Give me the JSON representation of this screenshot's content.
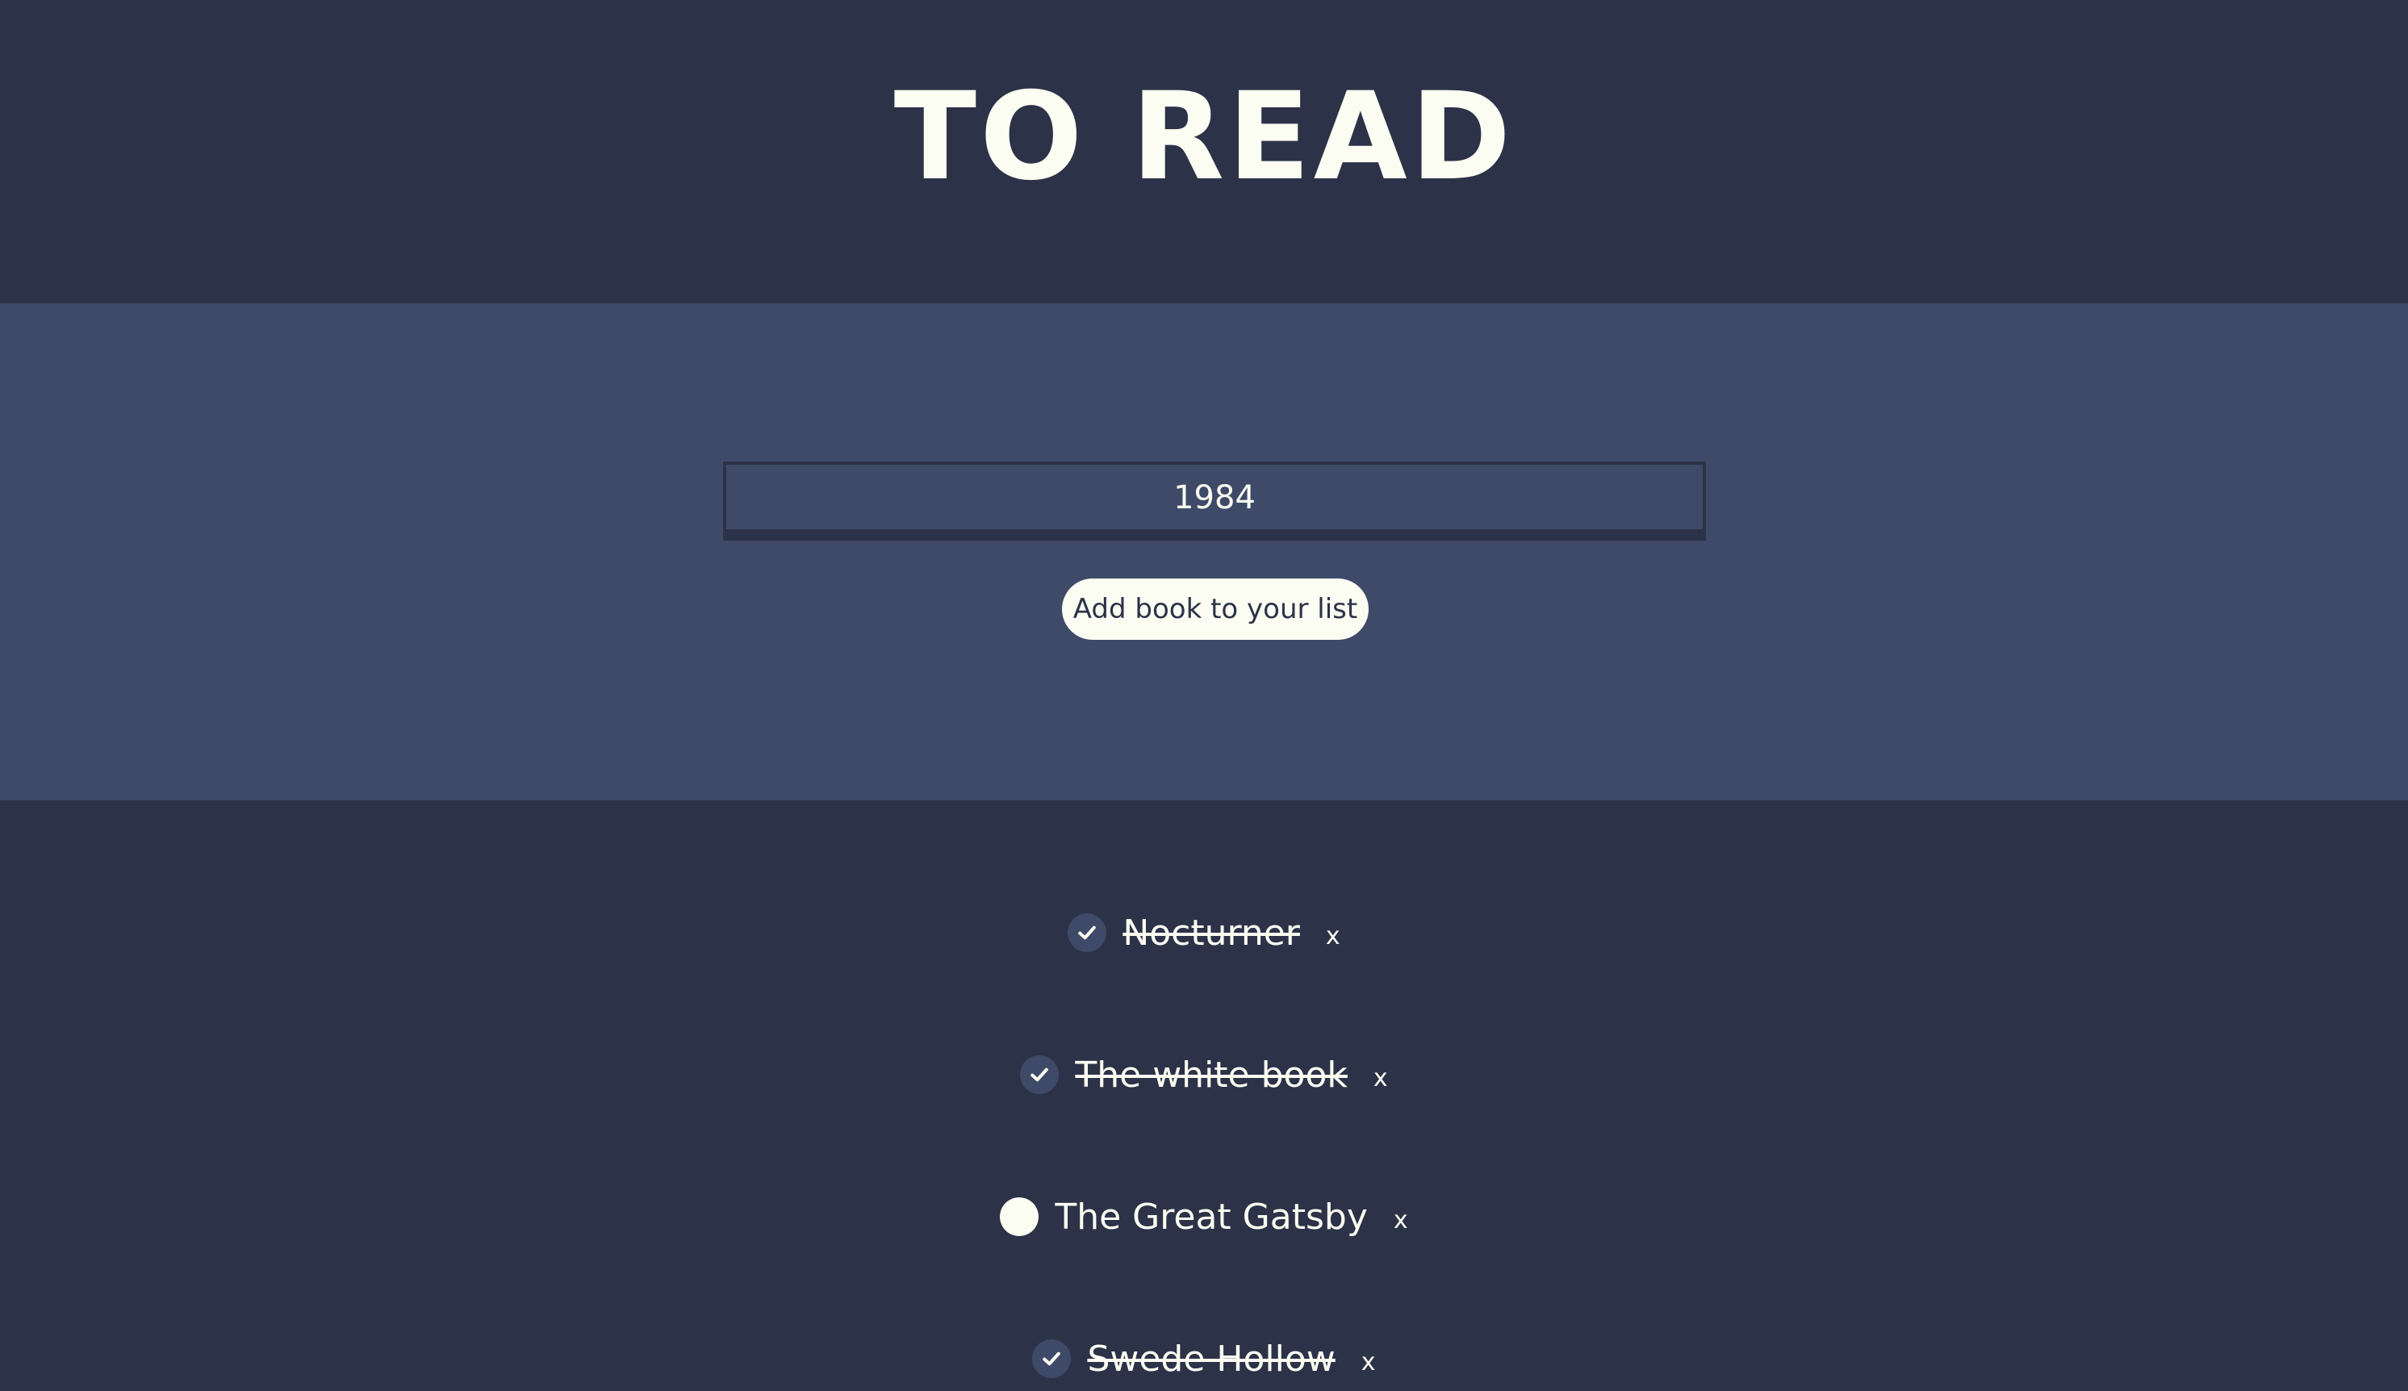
{
  "header": {
    "title": "TO READ"
  },
  "form": {
    "input_value": "1984",
    "add_button_label": "Add book to your list"
  },
  "books": [
    {
      "title": "Nocturner",
      "read": true,
      "remove_label": "x"
    },
    {
      "title": "The white book",
      "read": true,
      "remove_label": "x"
    },
    {
      "title": "The Great Gatsby",
      "read": false,
      "remove_label": "x"
    },
    {
      "title": "Swede Hollow",
      "read": true,
      "remove_label": "x"
    }
  ],
  "colors": {
    "background_dark": "#2c3348",
    "background_band": "#3e4a68",
    "text_light": "#fcfdf2"
  },
  "icons": {
    "read": "check-icon",
    "unread": "empty-circle-icon"
  }
}
